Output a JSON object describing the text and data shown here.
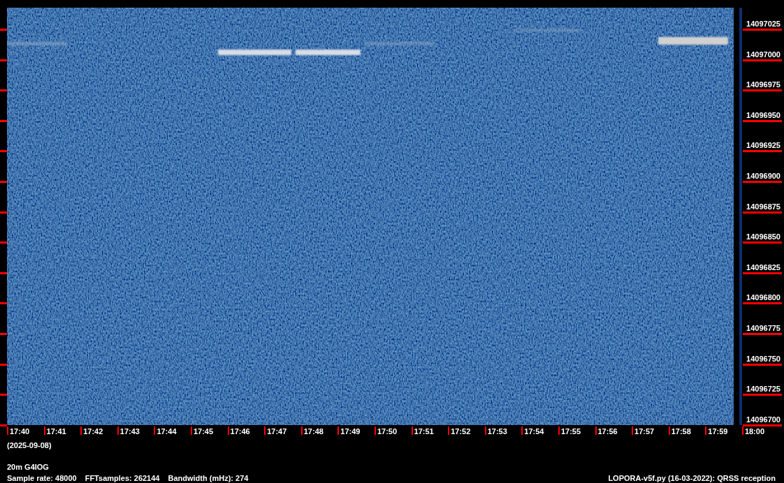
{
  "frequency_axis": {
    "labels": [
      "14097025",
      "14097000",
      "14096975",
      "14096950",
      "14096925",
      "14096900",
      "14096875",
      "14096850",
      "14096825",
      "14096800",
      "14096775",
      "14096750",
      "14096725",
      "14096700"
    ]
  },
  "time_axis": {
    "labels": [
      "17:40",
      "17:41",
      "17:42",
      "17:43",
      "17:44",
      "17:45",
      "17:46",
      "17:47",
      "17:48",
      "17:49",
      "17:50",
      "17:51",
      "17:52",
      "17:53",
      "17:54",
      "17:55",
      "17:56",
      "17:57",
      "17:58",
      "17:59",
      "18:00"
    ],
    "date": "(2025-09-08)"
  },
  "info": {
    "station": "20m G4IOG",
    "parameters": [
      "Sample rate: 48000",
      "FFTsamples: 262144",
      "Bandwidth (mHz): 274"
    ],
    "program": "LOPORA-v5f.py (16-03-2022): QRSS reception"
  }
}
